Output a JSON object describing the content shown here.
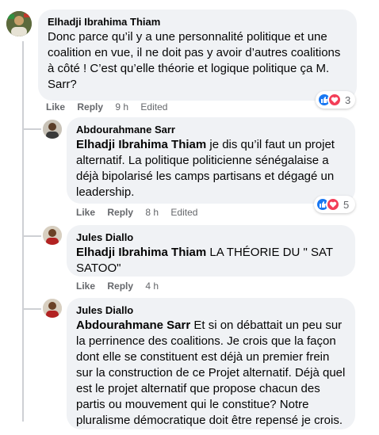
{
  "comments": [
    {
      "author": "Elhadji Ibrahima Thiam",
      "mention": "",
      "text": "Donc parce qu’il y a une personnalité politique et une coalition en vue, il ne doit pas y avoir d’autres coalitions à côté ! C’est qu’elle théorie et logique politique ça M. Sarr?",
      "like_label": "Like",
      "reply_label": "Reply",
      "time": "9 h",
      "edited": "Edited",
      "reaction_count": "3",
      "reactions": [
        "like-icon",
        "love-icon"
      ]
    },
    {
      "author": "Abdourahmane Sarr",
      "mention": "Elhadji Ibrahima Thiam",
      "text": " je dis qu’il faut un projet alternatif. La politique politicienne sénégalaise a déjà bipolarisé les camps partisans et dégagé un leadership.",
      "like_label": "Like",
      "reply_label": "Reply",
      "time": "8 h",
      "edited": "Edited",
      "reaction_count": "5",
      "reactions": [
        "like-icon",
        "love-icon"
      ]
    },
    {
      "author": "Jules Diallo",
      "mention": "Elhadji Ibrahima Thiam",
      "text": " LA THÉORIE DU \" SAT SATOO\"",
      "like_label": "Like",
      "reply_label": "Reply",
      "time": "4 h"
    },
    {
      "author": "Jules Diallo",
      "mention": "Abdourahmane Sarr",
      "text": " Et si on débattait un peu sur la perrinence des coalitions. Je crois que la façon dont elle se constituent est déjà un premier frein sur la construction de ce Projet alternatif. Déjà quel est le projet alternatif que propose chacun des partis ou mouvement qui le constitue? Notre pluralisme démocratique doit être repensé je crois."
    }
  ],
  "colors": {
    "bubble": "#f0f2f5",
    "meta_text": "#65676b",
    "like_blue": "#1877f2",
    "love_red": "#f33e58"
  }
}
